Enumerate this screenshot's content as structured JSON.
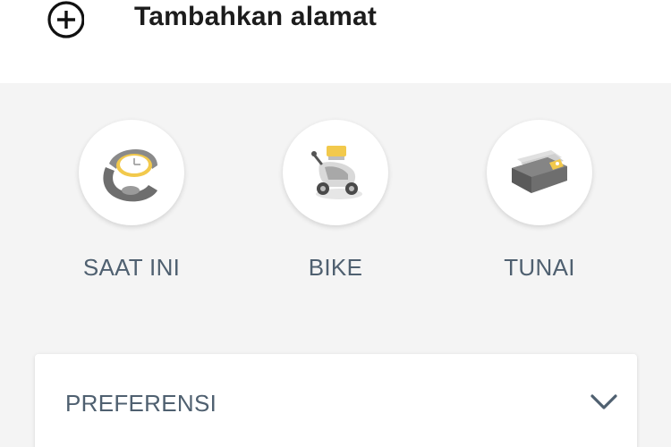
{
  "header": {
    "add_address_label": "Tambahkan alamat",
    "add_icon": "plus-circle-icon"
  },
  "options": [
    {
      "label": "SAAT INI",
      "icon": "watch-icon"
    },
    {
      "label": "BIKE",
      "icon": "scooter-icon"
    },
    {
      "label": "TUNAI",
      "icon": "wallet-icon"
    }
  ],
  "preferences": {
    "label": "PREFERENSI",
    "icon": "chevron-down-icon"
  },
  "colors": {
    "accent": "#f2c94c",
    "label_text": "#4f6070",
    "icon_gray": "#6b6b6b"
  }
}
